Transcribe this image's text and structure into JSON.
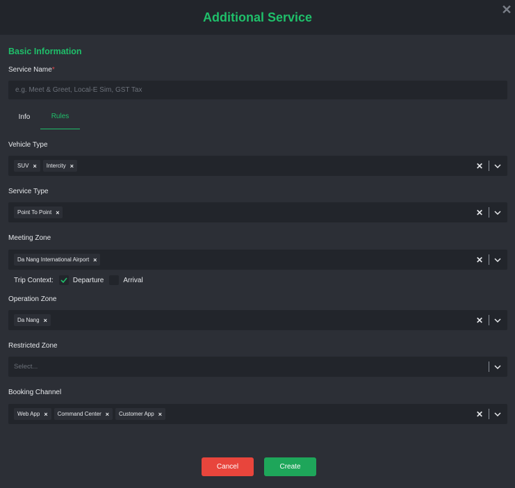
{
  "header": {
    "title": "Additional Service",
    "close_icon": "close-icon"
  },
  "basic_info": {
    "section_title": "Basic Information",
    "service_name_label": "Service Name",
    "required_mark": "*",
    "service_name_placeholder": "e.g. Meet & Greet, Local-E Sim, GST Tax",
    "service_name_value": ""
  },
  "tabs": [
    {
      "label": "Info",
      "active": false
    },
    {
      "label": "Rules",
      "active": true
    }
  ],
  "fields": {
    "vehicle_type": {
      "label": "Vehicle Type",
      "chips": [
        "SUV",
        "Intercity"
      ]
    },
    "service_type": {
      "label": "Service Type",
      "chips": [
        "Point To Point"
      ]
    },
    "meeting_zone": {
      "label": "Meeting Zone",
      "chips": [
        "Da Nang International Airport"
      ]
    },
    "operation_zone": {
      "label": "Operation Zone",
      "chips": [
        "Da Nang"
      ]
    },
    "restricted_zone": {
      "label": "Restricted Zone",
      "placeholder": "Select..."
    },
    "booking_channel": {
      "label": "Booking Channel",
      "chips": [
        "Web App",
        "Command Center",
        "Customer App"
      ]
    }
  },
  "trip_context": {
    "label": "Trip Context:",
    "options": [
      {
        "label": "Departure",
        "checked": true
      },
      {
        "label": "Arrival",
        "checked": false
      }
    ]
  },
  "actions": {
    "cancel_label": "Cancel",
    "create_label": "Create"
  },
  "colors": {
    "accent": "#1fbf6a",
    "danger": "#e8453c",
    "primary": "#1ea65a",
    "background": "#2c2f36",
    "header": "#22252b"
  }
}
